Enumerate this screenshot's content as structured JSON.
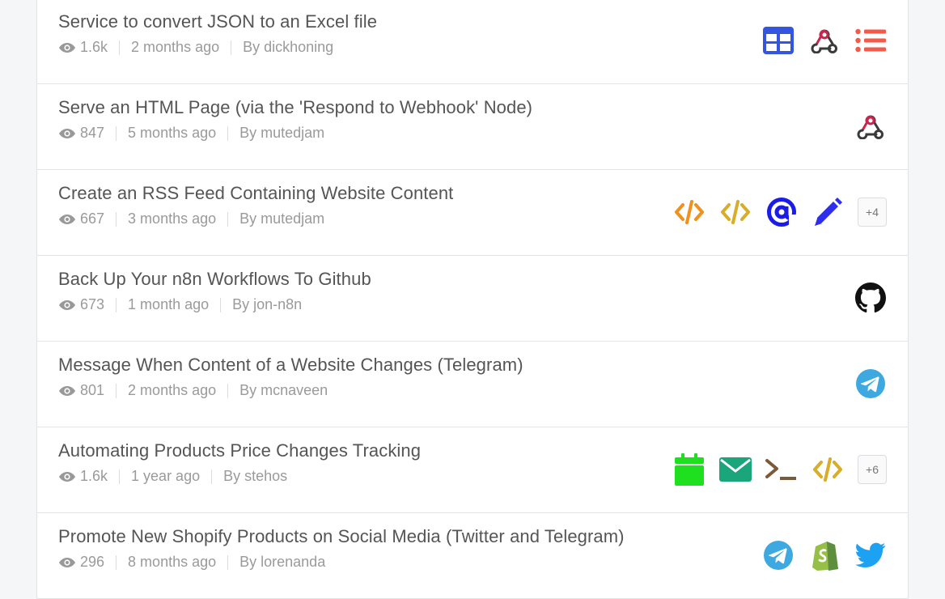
{
  "workflows": [
    {
      "title": "Service to convert JSON to an Excel file",
      "views": "1.6k",
      "age": "2 months ago",
      "author": "By dickhoning",
      "more": ""
    },
    {
      "title": "Serve an HTML Page (via the 'Respond to Webhook' Node)",
      "views": "847",
      "age": "5 months ago",
      "author": "By mutedjam",
      "more": ""
    },
    {
      "title": "Create an RSS Feed Containing Website Content",
      "views": "667",
      "age": "3 months ago",
      "author": "By mutedjam",
      "more": "+4"
    },
    {
      "title": "Back Up Your n8n Workflows To Github",
      "views": "673",
      "age": "1 month ago",
      "author": "By jon-n8n",
      "more": ""
    },
    {
      "title": "Message When Content of a Website Changes (Telegram)",
      "views": "801",
      "age": "2 months ago",
      "author": "By mcnaveen",
      "more": ""
    },
    {
      "title": "Automating Products Price Changes Tracking",
      "views": "1.6k",
      "age": "1 year ago",
      "author": "By stehos",
      "more": "+6"
    },
    {
      "title": "Promote New Shopify Products on Social Media (Twitter and Telegram)",
      "views": "296",
      "age": "8 months ago",
      "author": "By lorenanda",
      "more": ""
    }
  ],
  "icon_names": [
    [
      "spreadsheet-icon",
      "webhook-icon",
      "list-icon"
    ],
    [
      "webhook-icon"
    ],
    [
      "html-extract-icon",
      "html-code-icon",
      "email-at-icon",
      "edit-pencil-icon"
    ],
    [
      "github-icon"
    ],
    [
      "telegram-icon"
    ],
    [
      "calendar-icon",
      "email-envelope-icon",
      "terminal-icon",
      "html-code-icon"
    ],
    [
      "telegram-icon",
      "shopify-icon",
      "twitter-icon"
    ]
  ],
  "colors": {
    "spreadsheet": "#3355e0",
    "list": "#f25a4a",
    "code_orange": "#f0911e",
    "code_gold": "#d8ad2a",
    "at": "#1c1ce8",
    "pencil": "#2e2ef0",
    "telegram": "#3ea9e0",
    "calendar": "#1fe01f",
    "envelope": "#1aa57a",
    "terminal": "#7a5a3a",
    "shopify": "#95bf47",
    "twitter": "#1da1f2"
  }
}
